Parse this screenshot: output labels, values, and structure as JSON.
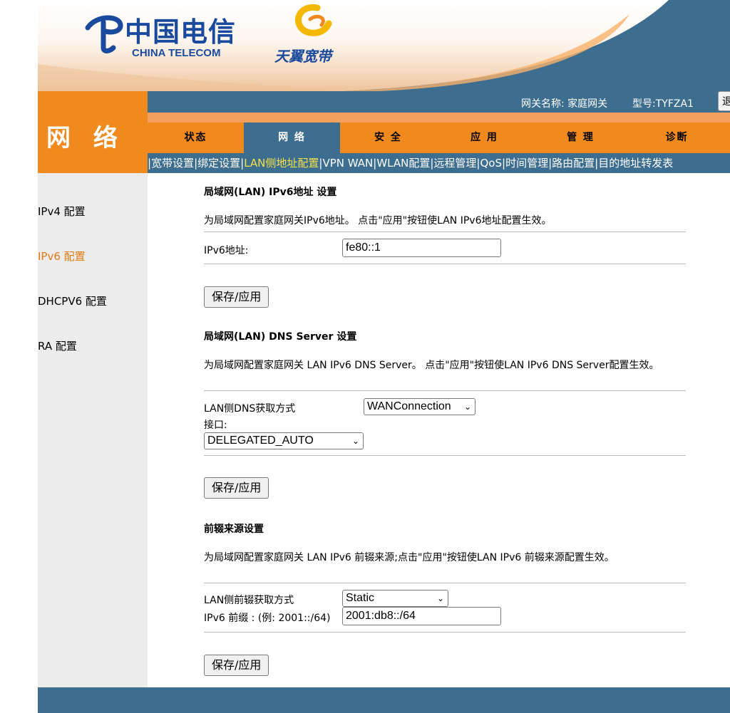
{
  "logo": {
    "brand_cn": "中国电信",
    "brand_en": "CHINA TELECOM",
    "tianyi": "天翼宽带"
  },
  "header": {
    "section_title": "网 络",
    "gateway_name": "网关名称: 家庭网关",
    "model": "型号:TYFZA1",
    "logout_label": "退"
  },
  "colors": {
    "nav_orange": "#f08a1f",
    "nav_blue": "#3d6e8f",
    "submenu_active": "#f5e04a",
    "left_active": "#e07b12"
  },
  "main_tabs": [
    {
      "label": "状态",
      "active": false
    },
    {
      "label": "网 络",
      "active": true
    },
    {
      "label": "安 全",
      "active": false
    },
    {
      "label": "应 用",
      "active": false
    },
    {
      "label": "管 理",
      "active": false
    },
    {
      "label": "诊断",
      "active": false
    }
  ],
  "sub_tabs": [
    {
      "label": "宽带设置",
      "active": false
    },
    {
      "label": "绑定设置",
      "active": false
    },
    {
      "label": "LAN侧地址配置",
      "active": true
    },
    {
      "label": "VPN WAN",
      "active": false
    },
    {
      "label": "WLAN配置",
      "active": false
    },
    {
      "label": "远程管理",
      "active": false
    },
    {
      "label": "QoS",
      "active": false
    },
    {
      "label": "时间管理",
      "active": false
    },
    {
      "label": "路由配置",
      "active": false
    },
    {
      "label": "目的地址转发表",
      "active": false
    }
  ],
  "sidebar": {
    "items": [
      {
        "label": "IPv4 配置",
        "active": false
      },
      {
        "label": "IPv6 配置",
        "active": true
      },
      {
        "label": "DHCPV6 配置",
        "active": false
      },
      {
        "label": "RA 配置",
        "active": false
      }
    ]
  },
  "lan_ipv6": {
    "title": "局域网(LAN) IPv6地址 设置",
    "description": "为局域网配置家庭网关IPv6地址。 点击\"应用\"按钮使LAN IPv6地址配置生效。",
    "address_label": "IPv6地址:",
    "address_value": "fe80::1",
    "save_label": "保存/应用"
  },
  "dns_server": {
    "title": "局域网(LAN) DNS Server 设置",
    "description": "为局域网配置家庭网关 LAN IPv6 DNS Server。 点击\"应用\"按钮使LAN IPv6 DNS Server配置生效。",
    "mode_label": "LAN侧DNS获取方式",
    "mode_value": "WANConnection",
    "interface_label": "接口:",
    "interface_value": "DELEGATED_AUTO",
    "save_label": "保存/应用"
  },
  "prefix": {
    "title": "前辍来源设置",
    "description": "为局域网配置家庭网关 LAN IPv6 前辍来源;点击\"应用\"按钮使LAN IPv6 前辍来源配置生效。",
    "mode_label": "LAN侧前辍获取方式",
    "mode_value": "Static",
    "prefix_label": "IPv6 前缀 : (例: 2001::/64)",
    "prefix_value": "2001:db8::/64",
    "save_label": "保存/应用"
  }
}
